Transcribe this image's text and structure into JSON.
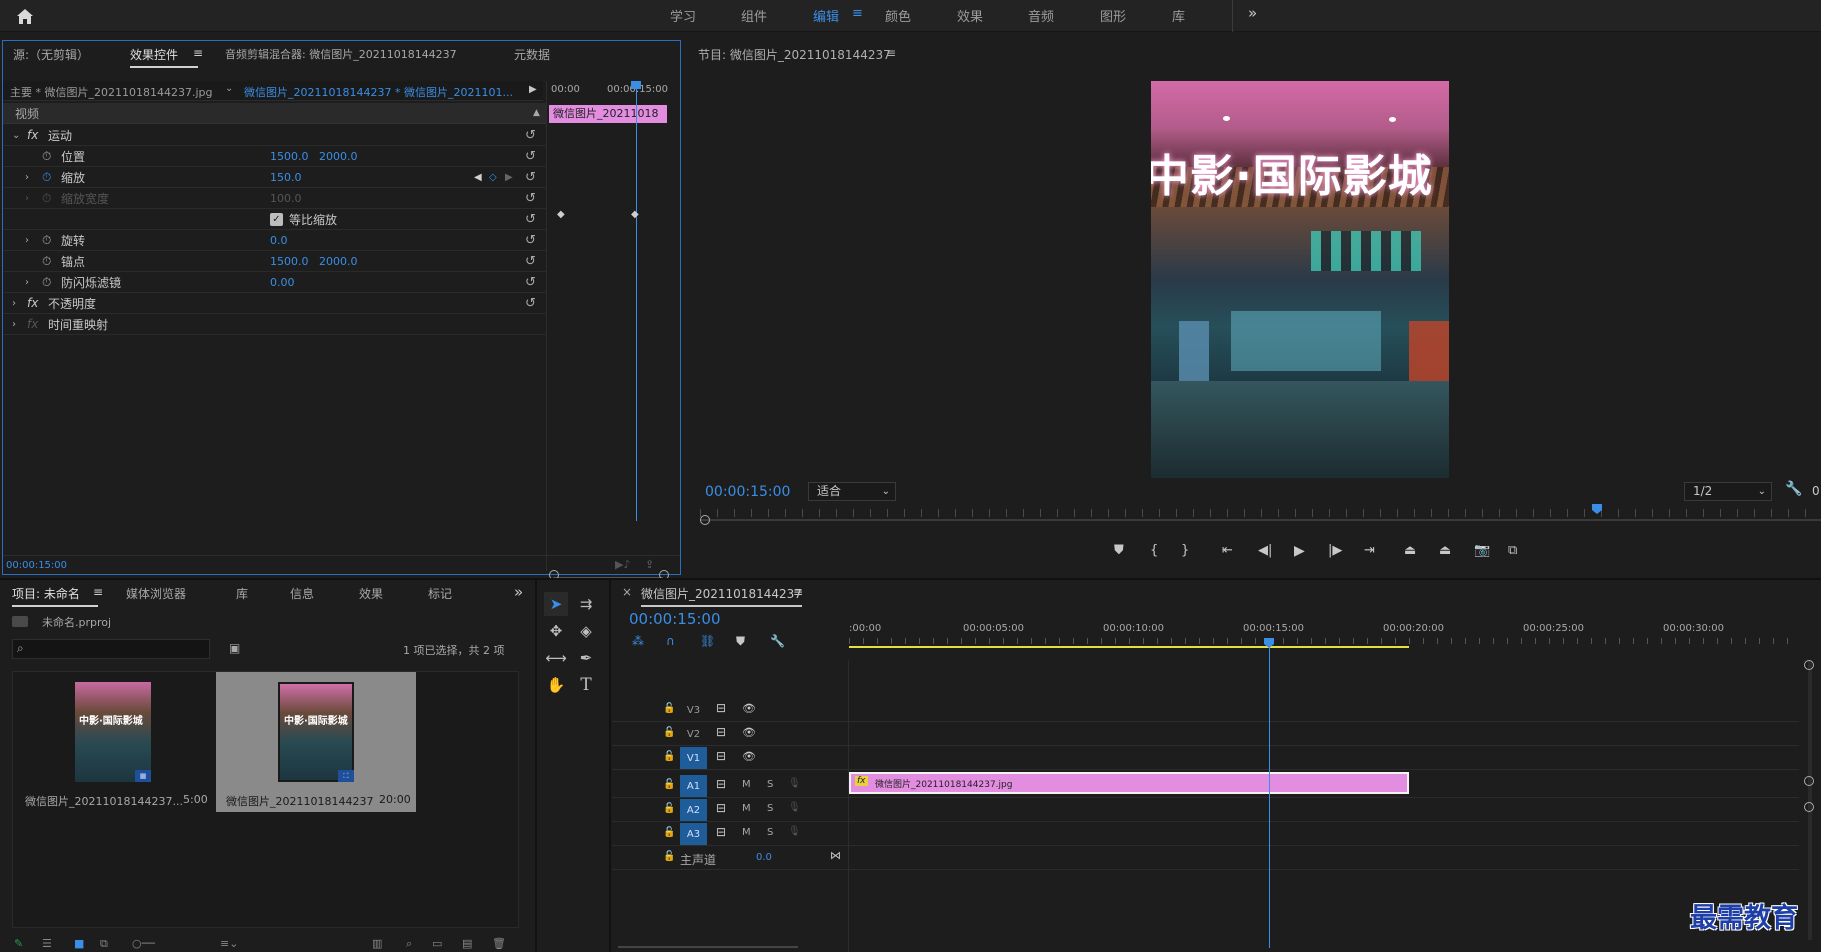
{
  "header": {
    "home_icon": "home-icon",
    "workspaces": [
      "学习",
      "组件",
      "编辑",
      "颜色",
      "效果",
      "音频",
      "图形",
      "库"
    ],
    "active_workspace": "编辑",
    "menu_glyph": "≡",
    "overflow": "»"
  },
  "effect_panel": {
    "tabs": [
      "源:（无剪辑）",
      "效果控件",
      "音频剪辑混合器: 微信图片_20211018144237",
      "元数据"
    ],
    "active_tab": "效果控件",
    "menu_glyph": "≡",
    "master_label": "主要 * 微信图片_20211018144237.jpg",
    "sequence_label": "微信图片_20211018144237 * 微信图片_2021101...",
    "mini_times": [
      "00:00",
      "00:00:15:00"
    ],
    "clip_label": "微信图片_20211018",
    "video_header": "视频",
    "motion": "运动",
    "position_label": "位置",
    "position_x": "1500.0",
    "position_y": "2000.0",
    "scale_label": "缩放",
    "scale_value": "150.0",
    "scale_width_label": "缩放宽度",
    "scale_width_value": "100.0",
    "uniform_label": "等比缩放",
    "rotation_label": "旋转",
    "rotation_value": "0.0",
    "anchor_label": "锚点",
    "anchor_x": "1500.0",
    "anchor_y": "2000.0",
    "flicker_label": "防闪烁滤镜",
    "flicker_value": "0.00",
    "opacity_label": "不透明度",
    "time_remap_label": "时间重映射",
    "fx_glyph": "fx",
    "current_time": "00:00:15:00"
  },
  "program_monitor": {
    "title": "节目: 微信图片_20211018144237",
    "menu_glyph": "≡",
    "timecode": "00:00:15:00",
    "fit_label": "适合",
    "resolution": "1/2",
    "image_sign": "中影·国际影城",
    "right_digit": "0",
    "playhead_position_fraction": 0.8
  },
  "project_panel": {
    "tabs": [
      "项目: 未命名",
      "媒体浏览器",
      "库",
      "信息",
      "效果",
      "标记"
    ],
    "active_tab": "项目: 未命名",
    "menu_glyph": "≡",
    "overflow": "»",
    "project_file": "未命名.prproj",
    "search_placeholder": "",
    "selection_status": "1 项已选择，共 2 项",
    "items": [
      {
        "name": "微信图片_20211018144237...",
        "duration": "5:00",
        "thumb_text": "中影·国际影城"
      },
      {
        "name": "微信图片_20211018144237",
        "duration": "20:00",
        "thumb_text": "中影·国际影城"
      }
    ]
  },
  "timeline": {
    "close_glyph": "×",
    "title": "微信图片_20211018144237",
    "menu_glyph": "≡",
    "timecode": "00:00:15:00",
    "ruler_labels": [
      ":00:00",
      "00:00:05:00",
      "00:00:10:00",
      "00:00:15:00",
      "00:00:20:00",
      "00:00:25:00",
      "00:00:30:00"
    ],
    "tracks": [
      {
        "name": "V3",
        "kind": "video",
        "targeted": false
      },
      {
        "name": "V2",
        "kind": "video",
        "targeted": false
      },
      {
        "name": "V1",
        "kind": "video",
        "targeted": true
      },
      {
        "name": "A1",
        "kind": "audio",
        "targeted": true
      },
      {
        "name": "A2",
        "kind": "audio",
        "targeted": true
      },
      {
        "name": "A3",
        "kind": "audio",
        "targeted": true
      }
    ],
    "mute_label": "M",
    "solo_label": "S",
    "master_label": "主声道",
    "master_value": "0.0",
    "clip_label": "微信图片_20211018144237.jpg",
    "clip_fx": "fx",
    "clip_start_seconds": 0,
    "clip_end_seconds": 20,
    "playhead_seconds": 15
  },
  "watermark": "最需教育",
  "colors": {
    "accent_blue": "#3a8ee6",
    "clip_pink": "#e38de0",
    "panel_bg": "#1d1d1d",
    "work_area_yellow": "#e8e03a"
  }
}
